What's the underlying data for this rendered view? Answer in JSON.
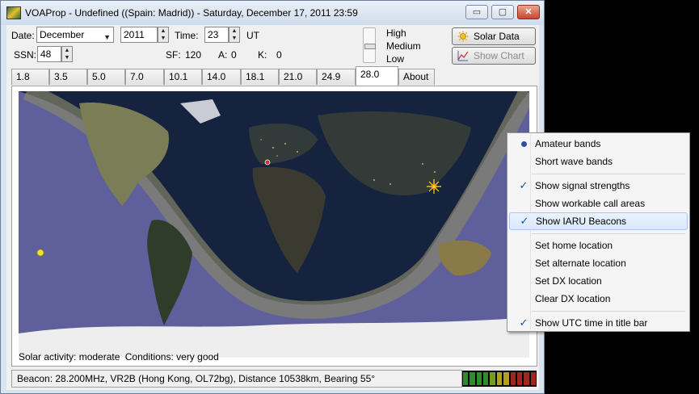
{
  "window": {
    "title": "VOAProp - Undefined ((Spain: Madrid)) - Saturday, December 17, 2011 23:59",
    "min_glyph": "▭",
    "max_glyph": "▢",
    "close_glyph": "✕"
  },
  "controls": {
    "date_label": "Date:",
    "month_value": "December",
    "year_value": "2011",
    "time_label": "Time:",
    "hour_value": "23",
    "time_unit": "UT",
    "ssn_label": "SSN:",
    "ssn_value": "48",
    "sf_label": "SF:",
    "sf_value": "120",
    "a_label": "A:",
    "a_value": "0",
    "k_label": "K:",
    "k_value": "0",
    "level_high": "High",
    "level_medium": "Medium",
    "level_low": "Low",
    "solar_data_label": "Solar Data",
    "show_chart_label": "Show Chart"
  },
  "tabs": [
    {
      "label": "1.8"
    },
    {
      "label": "3.5"
    },
    {
      "label": "5.0"
    },
    {
      "label": "7.0"
    },
    {
      "label": "10.1"
    },
    {
      "label": "14.0"
    },
    {
      "label": "18.1"
    },
    {
      "label": "21.0"
    },
    {
      "label": "24.9"
    },
    {
      "label": "28.0"
    },
    {
      "label": "About"
    }
  ],
  "active_tab": "28.0",
  "status": {
    "solar_activity_label": "Solar activity:",
    "solar_activity_value": "moderate",
    "conditions_label": "Conditions:",
    "conditions_value": "very good",
    "beacon_text": "Beacon: 28.200MHz, VR2B (Hong Kong, OL72bg), Distance 10538km, Bearing  55°"
  },
  "context_menu": {
    "items": [
      {
        "label": "Amateur bands",
        "mark": "radio"
      },
      {
        "label": "Short wave bands",
        "mark": ""
      },
      {
        "label": "Show signal strengths",
        "mark": "check"
      },
      {
        "label": "Show workable call areas",
        "mark": ""
      },
      {
        "label": "Show IARU Beacons",
        "mark": "check"
      },
      {
        "label": "Set home location",
        "mark": ""
      },
      {
        "label": "Set alternate location",
        "mark": ""
      },
      {
        "label": "Set DX location",
        "mark": ""
      },
      {
        "label": "Clear DX location",
        "mark": ""
      },
      {
        "label": "Show UTC time in title bar",
        "mark": "check"
      }
    ]
  },
  "signal_meter": {
    "colors": [
      "#2e8b2e",
      "#2e8b2e",
      "#2e8b2e",
      "#2e8b2e",
      "#7a9a1e",
      "#b0a21a",
      "#b0a21a",
      "#a0261e",
      "#a0261e",
      "#a0261e",
      "#a0261e"
    ],
    "active_segments": 11
  },
  "colors": {
    "accent": "#1c4fa0",
    "map_ocean": "#5f5f9b",
    "night_ocean": "#1a2a4c"
  }
}
